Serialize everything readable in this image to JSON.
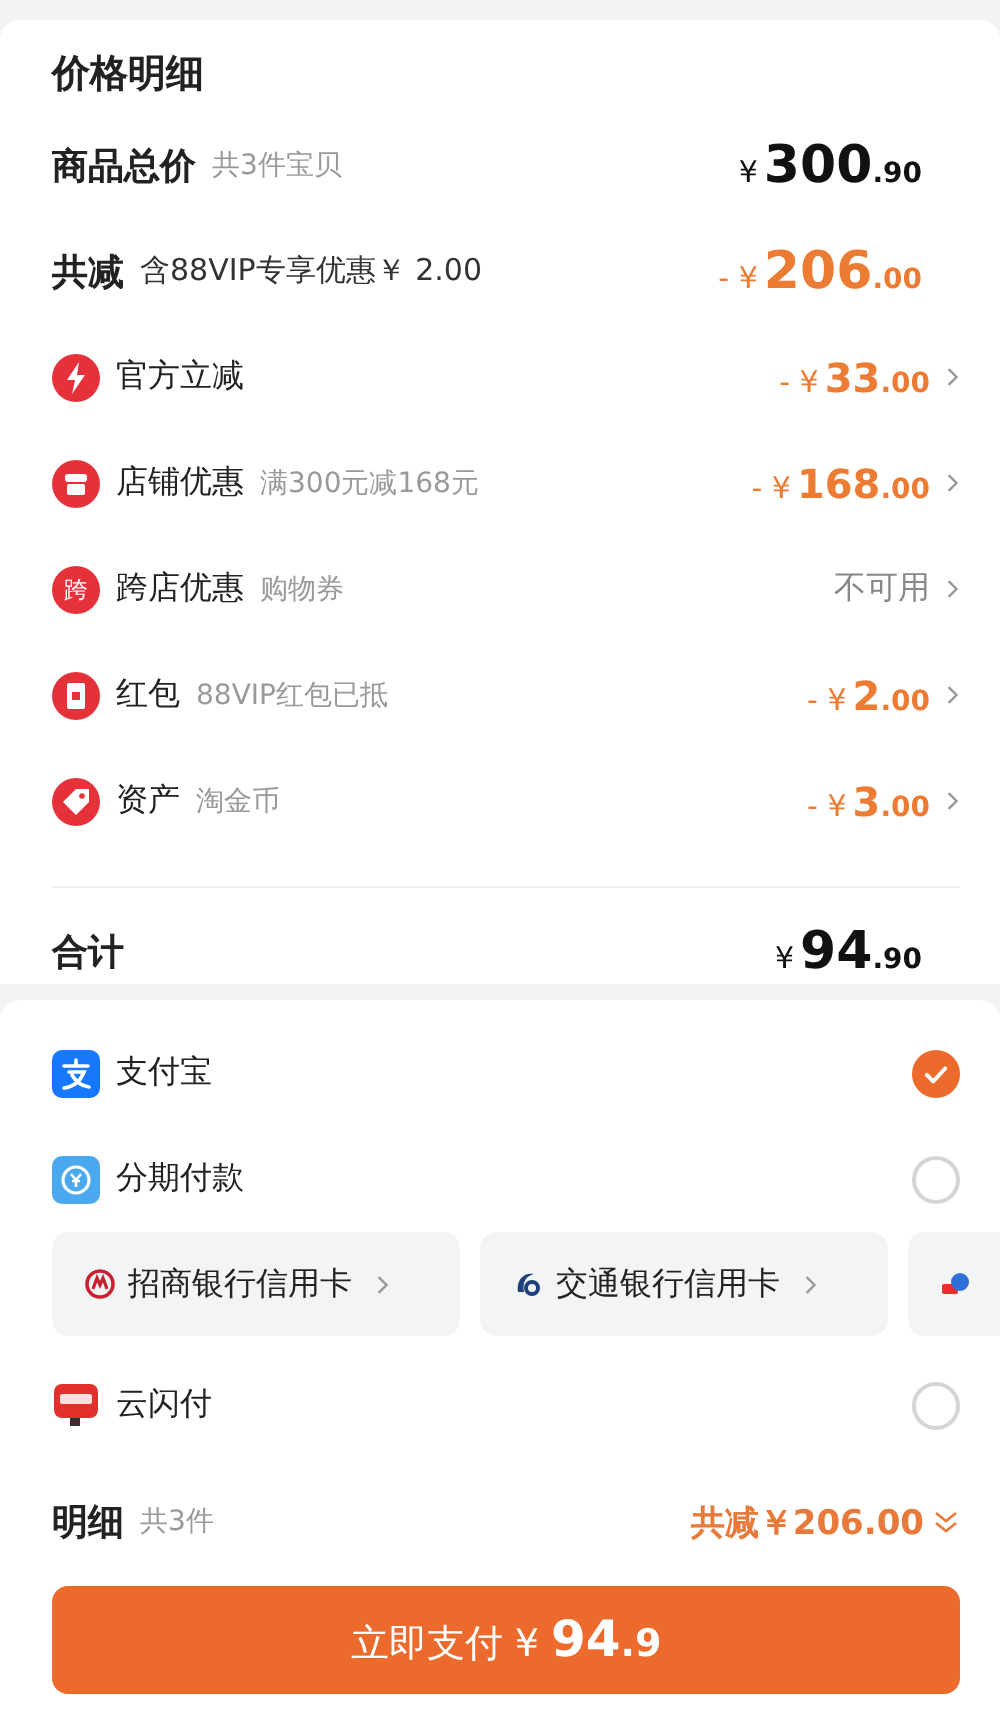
{
  "price_detail": {
    "title": "价格明细",
    "subtotal": {
      "label": "商品总价",
      "note": "共3件宝贝",
      "amount": {
        "prefix": "¥",
        "whole": "300",
        "fraction": ".90"
      }
    },
    "discount": {
      "label": "共减",
      "note": "含88VIP专享优惠￥ 2.00",
      "amount": {
        "prefix": "- ¥",
        "whole": "206",
        "fraction": ".00"
      }
    },
    "items": [
      {
        "kind": "bolt",
        "label": "官方立减",
        "amount": {
          "prefix": "- ¥",
          "whole": "33",
          "fraction": ".00"
        }
      },
      {
        "kind": "store",
        "label": "店铺优惠",
        "note": "满300元减168元",
        "amount": {
          "prefix": "- ¥",
          "whole": "168",
          "fraction": ".00"
        }
      },
      {
        "kind": "glyph",
        "badge": "跨",
        "label": "跨店优惠",
        "note": "购物券",
        "status": "不可用"
      },
      {
        "kind": "envelope",
        "label": "红包",
        "note": "88VIP红包已抵",
        "amount": {
          "prefix": "- ¥",
          "whole": "2",
          "fraction": ".00"
        }
      },
      {
        "kind": "tag",
        "label": "资产",
        "note": "淘金币",
        "amount": {
          "prefix": "- ¥",
          "whole": "3",
          "fraction": ".00"
        }
      }
    ],
    "total": {
      "label": "合计",
      "amount": {
        "prefix": "¥",
        "whole": "94",
        "fraction": ".90"
      }
    }
  },
  "payment": {
    "methods": [
      {
        "kind": "method",
        "label": "支付宝",
        "selected": true
      },
      {
        "kind": "method",
        "label": "分期付款",
        "selected": false
      },
      {
        "kind": "cards",
        "cards": [
          {
            "label": "招商银行信用卡"
          },
          {
            "label": "交通银行信用卡"
          }
        ]
      },
      {
        "kind": "method",
        "label": "云闪付",
        "selected": false
      }
    ],
    "summary": {
      "label": "明细",
      "count": "共3件",
      "discount": "共减￥206.00"
    },
    "pay_button": {
      "label": "立即支付 ¥ ",
      "whole": "94",
      "fraction": ".9"
    }
  }
}
